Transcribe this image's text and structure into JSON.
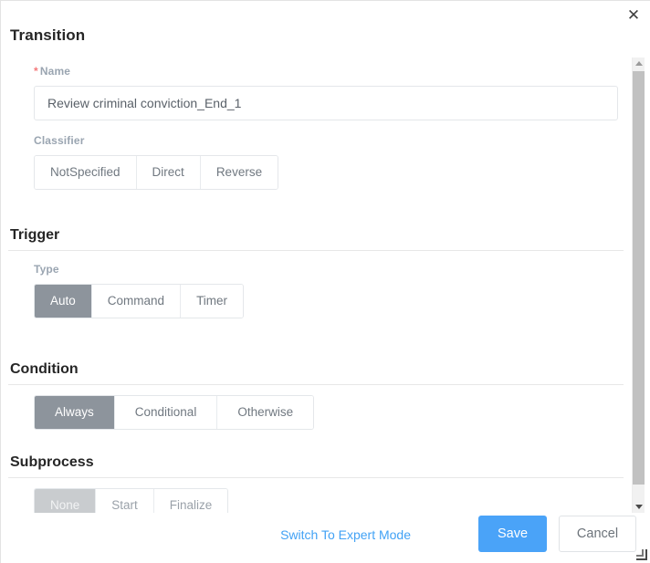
{
  "dialog": {
    "title": "Transition",
    "close_icon": "close-icon"
  },
  "form": {
    "name_field": {
      "label": "Name",
      "required_marker": "*",
      "value": "Review criminal conviction_End_1",
      "placeholder": "Name"
    },
    "classifier_field": {
      "label": "Classifier",
      "options": [
        "NotSpecified",
        "Direct",
        "Reverse"
      ],
      "selected": null
    }
  },
  "sections": [
    {
      "heading": "Trigger",
      "field_label": "Type",
      "options": [
        "Auto",
        "Command",
        "Timer"
      ],
      "selected": "Auto",
      "disabled": false
    },
    {
      "heading": "Condition",
      "field_label": "",
      "options": [
        "Always",
        "Conditional",
        "Otherwise"
      ],
      "selected": "Always",
      "disabled": false
    },
    {
      "heading": "Subprocess",
      "field_label": "",
      "options": [
        "None",
        "Start",
        "Finalize"
      ],
      "selected": "None",
      "disabled": true
    }
  ],
  "footer": {
    "switch_expert_label": "Switch To Expert Mode",
    "save_label": "Save",
    "cancel_label": "Cancel"
  },
  "scrollbar": {
    "up_arrow_icon": "chevron-up-icon",
    "down_arrow_icon": "chevron-down-icon"
  },
  "colors": {
    "accent_blue": "#4aa3f8",
    "link_blue": "#42a2f5",
    "active_segment_gray": "#8d949c",
    "disabled_segment_gray": "#c9cccf",
    "required_star_red": "#f4797b",
    "label_gray": "#9aa5b1"
  }
}
